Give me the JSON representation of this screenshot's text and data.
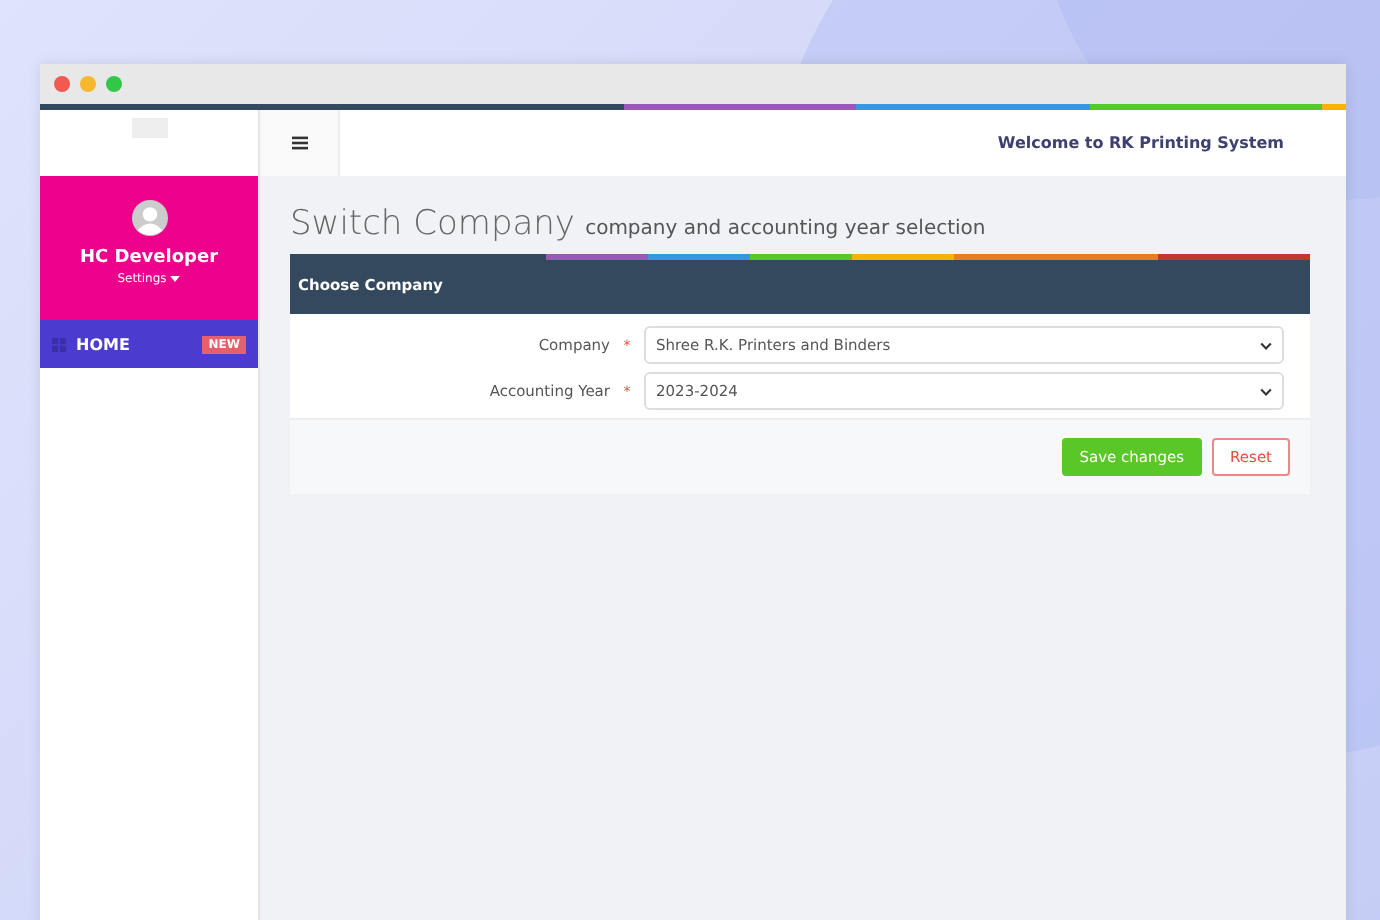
{
  "sidebar": {
    "user_name": "HC Developer",
    "settings_label": "Settings",
    "menu": [
      {
        "label": "HOME",
        "badge": "NEW",
        "selected": true
      }
    ]
  },
  "topbar": {
    "welcome": "Welcome to RK Printing System"
  },
  "page": {
    "title": "Switch Company",
    "subtitle": "company and accounting year selection"
  },
  "panel": {
    "title": "Choose Company",
    "fields": [
      {
        "label": "Company",
        "required_mark": "*",
        "value": "Shree R.K. Printers and Binders"
      },
      {
        "label": "Accounting Year",
        "required_mark": "*",
        "value": "2023-2024"
      }
    ],
    "buttons": [
      {
        "label": "Save changes",
        "kind": "primary"
      },
      {
        "label": "Reset",
        "kind": "outline"
      }
    ]
  }
}
